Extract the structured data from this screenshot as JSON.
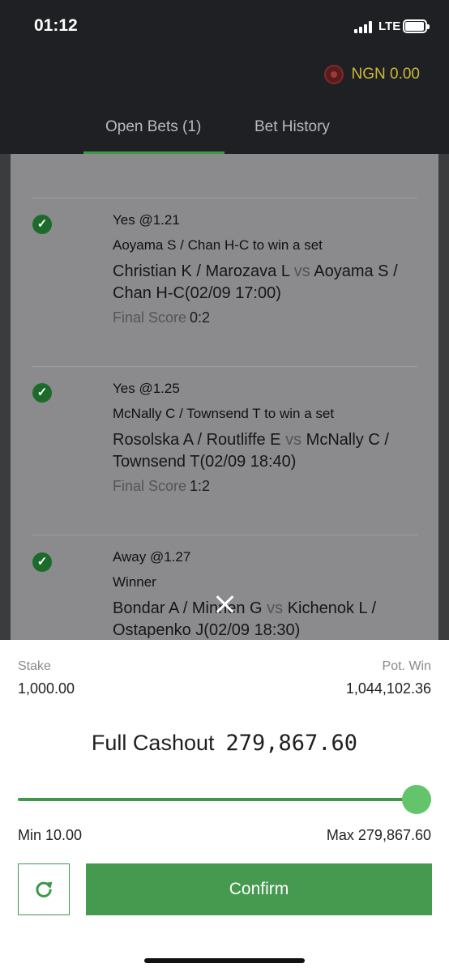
{
  "status_bar": {
    "time": "01:12",
    "network": "LTE"
  },
  "header": {
    "balance": "NGN 0.00",
    "tabs": [
      {
        "label": "Open Bets (1)",
        "active": true
      },
      {
        "label": "Bet History",
        "active": false
      }
    ]
  },
  "bets": [
    {
      "pick": "Yes @1.21",
      "market": "Aoyama S / Chan H-C to win a set",
      "home": "Christian K / Marozava L",
      "vs": "vs",
      "away": "Aoyama S / Chan H-C",
      "datetime": "(02/09 17:00)",
      "score_label": "Final Score",
      "score": "0:2"
    },
    {
      "pick": "Yes @1.25",
      "market": "McNally C / Townsend T to win a set",
      "home": "Rosolska A / Routliffe E",
      "vs": "vs",
      "away": "McNally C / Townsend T",
      "datetime": "(02/09 18:40)",
      "score_label": "Final Score",
      "score": "1:2"
    },
    {
      "pick": "Away @1.27",
      "market": "Winner",
      "home": "Bondar A / Minnen G",
      "vs": "vs",
      "away": "Kichenok L / Ostapenko J",
      "datetime": "(02/09 18:30)"
    }
  ],
  "sheet": {
    "stake_label": "Stake",
    "stake_value": "1,000.00",
    "pot_win_label": "Pot. Win",
    "pot_win_value": "1,044,102.36",
    "cashout_label": "Full Cashout",
    "cashout_amount": "279,867.60",
    "slider_fraction": 1.0,
    "min_label": "Min 10.00",
    "max_label": "Max 279,867.60",
    "confirm_label": "Confirm"
  },
  "colors": {
    "accent_green": "#459a4f",
    "thumb_green": "#63c46c",
    "balance_gold": "#c9b83b",
    "dark_bg": "#1f2023"
  },
  "icons": [
    "signal-icon",
    "battery-icon",
    "wallet-icon",
    "check-icon",
    "close-icon",
    "refresh-icon"
  ]
}
